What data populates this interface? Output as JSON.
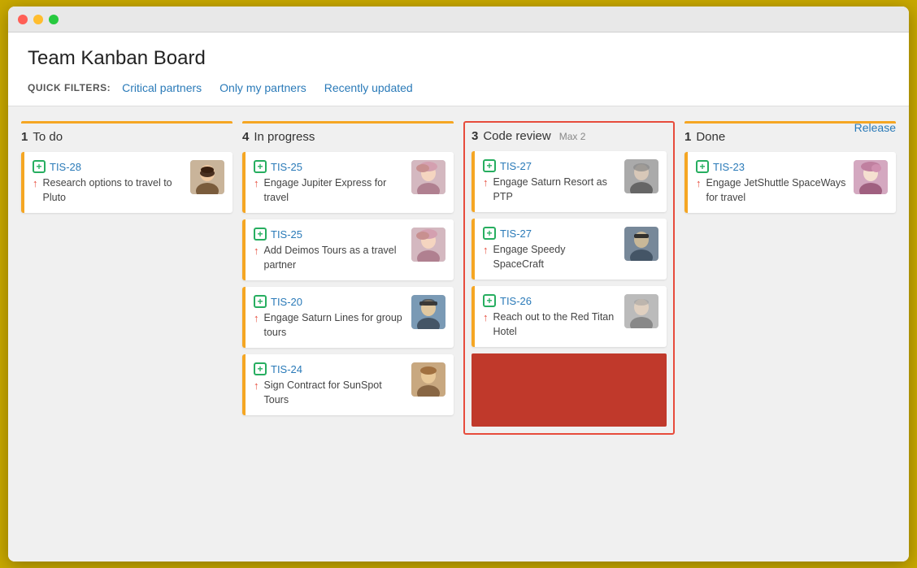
{
  "window": {
    "title": "Team Kanban Board"
  },
  "titlebar": {
    "dots": [
      "red",
      "yellow",
      "green"
    ]
  },
  "header": {
    "page_title": "Team Kanban Board",
    "quick_filters_label": "QUICK FILTERS:",
    "filters": [
      {
        "id": "critical-partners",
        "label": "Critical partners"
      },
      {
        "id": "only-my-partners",
        "label": "Only my partners"
      },
      {
        "id": "recently-updated",
        "label": "Recently updated"
      }
    ]
  },
  "board": {
    "release_label": "Release",
    "columns": [
      {
        "id": "todo",
        "count": "1",
        "title": "To do",
        "max": null,
        "cards": [
          {
            "id": "TIS-28",
            "desc": "Research options to travel to Pluto",
            "avatar_color": "#8B7355",
            "has_arrow": true
          }
        ]
      },
      {
        "id": "inprogress",
        "count": "4",
        "title": "In progress",
        "max": null,
        "cards": [
          {
            "id": "TIS-25",
            "desc": "Engage Jupiter Express for travel",
            "avatar_color": "#c8a0a0",
            "has_arrow": true
          },
          {
            "id": "TIS-25",
            "desc": "Add Deimos Tours as a travel partner",
            "avatar_color": "#c8a0a0",
            "has_arrow": true
          },
          {
            "id": "TIS-20",
            "desc": "Engage Saturn Lines for group tours",
            "avatar_color": "#6688aa",
            "has_arrow": true
          },
          {
            "id": "TIS-24",
            "desc": "Sign Contract for SunSpot Tours",
            "avatar_color": "#aa8866",
            "has_arrow": true
          }
        ]
      },
      {
        "id": "codereview",
        "count": "3",
        "title": "Code review",
        "max": "Max 2",
        "cards": [
          {
            "id": "TIS-27",
            "desc": "Engage Saturn Resort as PTP",
            "avatar_color": "#888888",
            "has_arrow": true
          },
          {
            "id": "TIS-27",
            "desc": "Engage Speedy SpaceCraft",
            "avatar_color": "#556677",
            "has_arrow": true
          },
          {
            "id": "TIS-26",
            "desc": "Reach out to the Red Titan Hotel",
            "avatar_color": "#aaaaaa",
            "has_arrow": true
          }
        ]
      },
      {
        "id": "done",
        "count": "1",
        "title": "Done",
        "max": null,
        "cards": [
          {
            "id": "TIS-23",
            "desc": "Engage JetShuttle SpaceWays for travel",
            "avatar_color": "#c8a0b8",
            "has_arrow": true
          }
        ]
      }
    ]
  }
}
